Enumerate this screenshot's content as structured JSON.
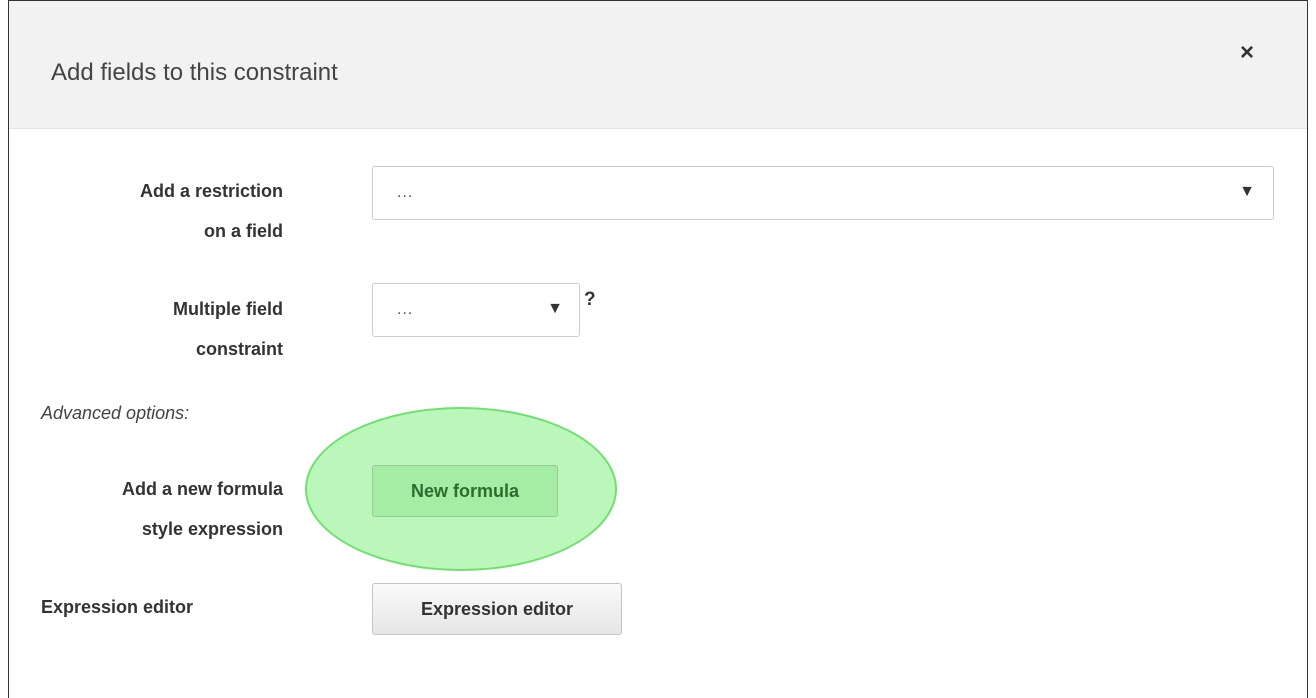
{
  "dialog": {
    "title": "Add fields to this constraint",
    "close_label": "×"
  },
  "restriction": {
    "label_line1": "Add a restriction",
    "label_line2": "on a field",
    "selected_value": "...",
    "arrow": "▼"
  },
  "multiple": {
    "label_line1": "Multiple field",
    "label_line2": "constraint",
    "selected_value": "...",
    "arrow": "▼",
    "help": "?"
  },
  "advanced": {
    "heading": "Advanced options:",
    "formula_label_line1": "Add a new formula",
    "formula_label_line2": "style expression",
    "formula_button": "New formula",
    "editor_label": "Expression editor",
    "editor_button": "Expression editor"
  },
  "colors": {
    "highlight": "#8cf08c",
    "header_bg": "#f2f2f2"
  }
}
